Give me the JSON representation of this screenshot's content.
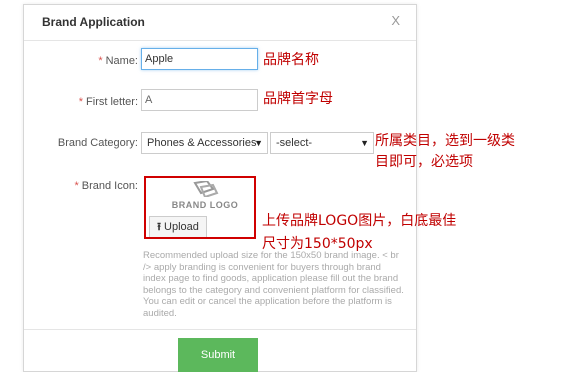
{
  "dialog": {
    "title": "Brand Application",
    "close_label": "X"
  },
  "form": {
    "name_label": "Name:",
    "name_value": "Apple",
    "first_letter_label": "First letter:",
    "first_letter_value": "A",
    "category_label": "Brand Category:",
    "category_primary": "Phones & Accessories",
    "category_secondary": "-select-",
    "icon_label": "Brand Icon:",
    "logo_placeholder_text": "BRAND LOGO",
    "upload_label": "Upload",
    "hint": "Recommended upload size for the 150x50 brand image. < br /> apply branding is convenient for buyers through brand index page to find goods, application please fill out the brand belongs to the category and convenient platform for classified. You can edit or cancel the application before the platform is audited.",
    "submit_label": "Submit",
    "required_marker": "*"
  },
  "annotations": {
    "name_note": "品牌名称",
    "first_letter_note": "品牌首字母",
    "category_note_line1": "所属类目，选到一级类",
    "category_note_line2": "目即可，必选项",
    "logo_note_line1": "上传品牌LOGO图片，白底最佳",
    "logo_note_line2": "尺寸为150*50px"
  },
  "colors": {
    "submit": "#5cb85c",
    "required": "#d9534f",
    "annotation": "#c00000"
  },
  "icons": {
    "upload": "upload-icon",
    "dropdown": "chevron-down-icon"
  }
}
